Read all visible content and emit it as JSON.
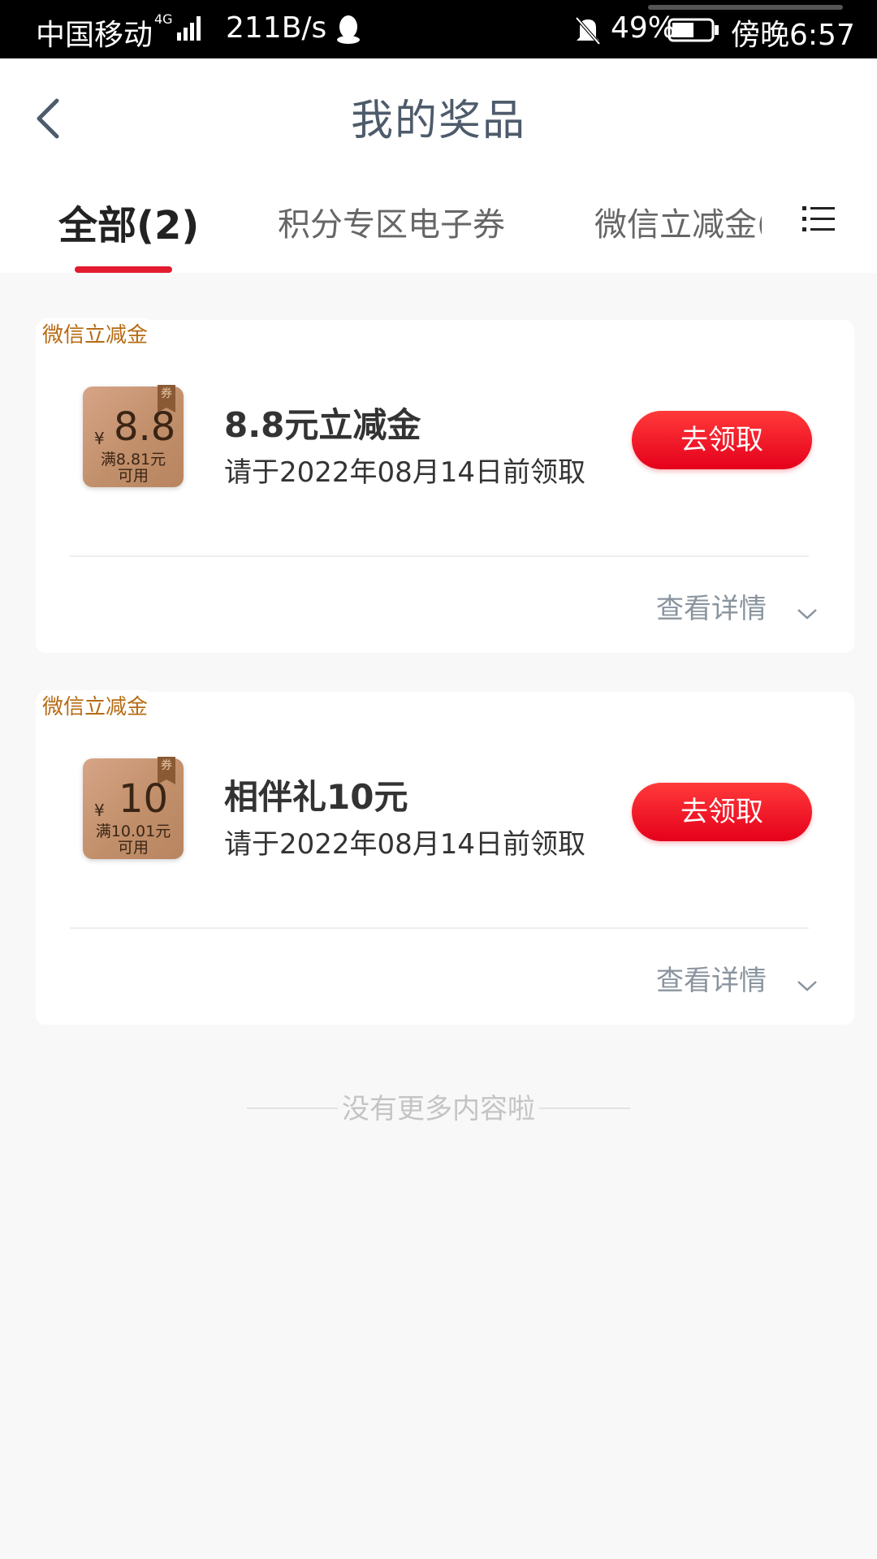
{
  "status_bar": {
    "carrier": "中国移动",
    "network": "4G",
    "speed": "211B/s",
    "battery": "49%",
    "time": "傍晚6:57",
    "icons": [
      "signal-icon",
      "qq-icon",
      "mute-icon",
      "battery-icon"
    ]
  },
  "header": {
    "title": "我的奖品",
    "back_icon": "chevron-left-icon"
  },
  "tabs": [
    {
      "label": "全部(2)",
      "active": true
    },
    {
      "label": "积分专区电子券",
      "active": false
    },
    {
      "label": "微信立减金(",
      "active": false
    }
  ],
  "menu_icon": "list-menu-icon",
  "cards": [
    {
      "tag": "微信立减金",
      "coupon": {
        "currency": "¥",
        "amount": "8.8",
        "condition_line1": "满8.81元",
        "condition_line2": "可用",
        "ribbon": "券"
      },
      "title": "8.8元立减金",
      "deadline": "请于2022年08月14日前领取",
      "button": "去领取",
      "details": "查看详情"
    },
    {
      "tag": "微信立减金",
      "coupon": {
        "currency": "¥",
        "amount": "10",
        "condition_line1": "满10.01元",
        "condition_line2": "可用",
        "ribbon": "券"
      },
      "title": "相伴礼10元",
      "deadline": "请于2022年08月14日前领取",
      "button": "去领取",
      "details": "查看详情"
    }
  ],
  "footer": {
    "no_more": "没有更多内容啦"
  },
  "colors": {
    "accent": "#e31b2e",
    "tag": "#b76b13",
    "button_top": "#ff3a3a",
    "button_bottom": "#e5001b"
  }
}
